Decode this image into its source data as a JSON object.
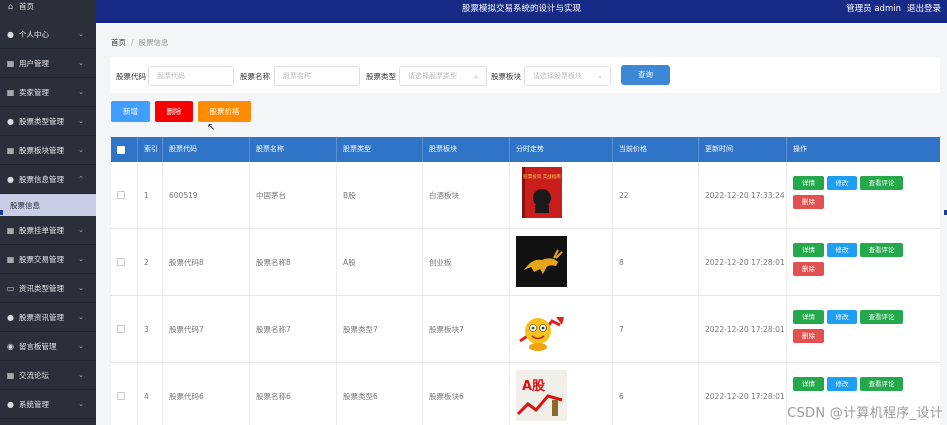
{
  "header": {
    "title": "股票模拟交易系统的设计与实现",
    "user_label": "管理员 admin",
    "logout_label": "退出登录"
  },
  "sidebar": {
    "items": [
      {
        "label": "首页",
        "icon": "home-icon"
      },
      {
        "label": "个人中心",
        "icon": "user-icon"
      },
      {
        "label": "用户管理",
        "icon": "grid-icon"
      },
      {
        "label": "卖家管理",
        "icon": "grid-icon"
      },
      {
        "label": "股票类型管理",
        "icon": "user-icon"
      },
      {
        "label": "股票板块管理",
        "icon": "grid-icon"
      },
      {
        "label": "股票信息管理",
        "icon": "user-icon"
      },
      {
        "label": "股票信息",
        "icon": ""
      },
      {
        "label": "股票挂单管理",
        "icon": "grid-icon"
      },
      {
        "label": "股票交易管理",
        "icon": "grid-icon"
      },
      {
        "label": "资讯类型管理",
        "icon": "monitor-icon"
      },
      {
        "label": "股票资讯管理",
        "icon": "user-icon"
      },
      {
        "label": "留言板管理",
        "icon": "pin-icon"
      },
      {
        "label": "交流论坛",
        "icon": "grid-icon"
      },
      {
        "label": "系统管理",
        "icon": "user-icon"
      }
    ]
  },
  "breadcrumb": {
    "home": "首页",
    "current": "股票信息"
  },
  "search": {
    "code_label": "股票代码",
    "code_placeholder": "股票代码",
    "name_label": "股票名称",
    "name_placeholder": "股票名称",
    "type_label": "股票类型",
    "type_placeholder": "请选择股票类型",
    "board_label": "股票板块",
    "board_placeholder": "请选择股票板块",
    "search_button": "查询"
  },
  "actions": {
    "add": "新增",
    "delete": "删除",
    "price": "股票价格"
  },
  "table": {
    "columns": [
      "索引",
      "股票代码",
      "股票名称",
      "股票类型",
      "股票板块",
      "分时走势",
      "当前价格",
      "更新时间",
      "操作"
    ],
    "rows": [
      {
        "index": "1",
        "code": "600519",
        "name": "中国茅台",
        "type": "B股",
        "board": "白酒板块",
        "price": "22",
        "updated": "2022-12-20 17:33:24",
        "thumb": "book"
      },
      {
        "index": "2",
        "code": "股票代码8",
        "name": "股票名称8",
        "type": "A股",
        "board": "创业板",
        "price": "8",
        "updated": "2022-12-20 17:28:01",
        "thumb": "bull"
      },
      {
        "index": "3",
        "code": "股票代码7",
        "name": "股票名称7",
        "type": "股票类型7",
        "board": "股票板块7",
        "price": "7",
        "updated": "2022-12-20 17:28:01",
        "thumb": "cartoon"
      },
      {
        "index": "4",
        "code": "股票代码6",
        "name": "股票名称6",
        "type": "股票类型6",
        "board": "股票板块6",
        "price": "6",
        "updated": "2022-12-20 17:28:01",
        "thumb": "chart"
      }
    ],
    "op_labels": {
      "detail": "详情",
      "edit": "修改",
      "review": "查看评论",
      "remove": "删除"
    }
  },
  "thumb_text": {
    "book": "股票投资 实战指南",
    "chart": "A股"
  },
  "watermark": "CSDN @计算机程序_设计",
  "colors": {
    "header": "#162a86",
    "sidebar": "#2b2f3a",
    "table_head": "#2f74c6",
    "add": "#409eff",
    "delete": "#f80000",
    "price": "#ff8c00",
    "search": "#3c87d6"
  }
}
